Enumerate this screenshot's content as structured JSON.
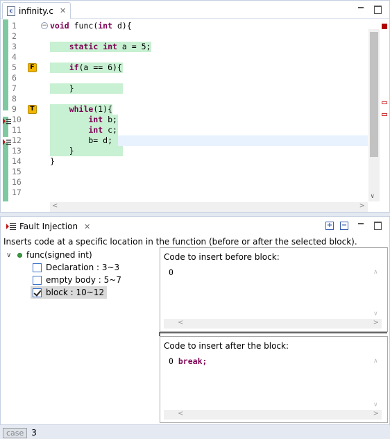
{
  "editor": {
    "tab_label": "infinity.c",
    "file_icon_glyph": "c",
    "lines": [
      {
        "no": "1",
        "code": "void func(int d){",
        "kw": true,
        "fold": true
      },
      {
        "no": "2",
        "code": ""
      },
      {
        "no": "3",
        "code": "    static int a = 5;",
        "hl": true
      },
      {
        "no": "4",
        "code": ""
      },
      {
        "no": "5",
        "code": "    if(a == 6){",
        "hl": true,
        "marker": "F"
      },
      {
        "no": "6",
        "code": ""
      },
      {
        "no": "7",
        "code": "    }",
        "hl": true
      },
      {
        "no": "8",
        "code": ""
      },
      {
        "no": "9",
        "code": "    while(1){",
        "hl": true,
        "marker": "T"
      },
      {
        "no": "10",
        "code": "        int b;",
        "hl": true,
        "bp": true
      },
      {
        "no": "11",
        "code": "        int c;",
        "hl": true
      },
      {
        "no": "12",
        "code": "        b= d;",
        "hl": true,
        "bp": true,
        "selected": true
      },
      {
        "no": "13",
        "code": "    }",
        "hl": true
      },
      {
        "no": "14",
        "code": "}"
      },
      {
        "no": "15",
        "code": ""
      },
      {
        "no": "16",
        "code": ""
      },
      {
        "no": "17",
        "code": ""
      }
    ]
  },
  "fault_injection": {
    "tab_label": "Fault Injection",
    "description": "Inserts code at a specific location in the function (before or after the selected block).",
    "tree": {
      "function": "func(signed int)",
      "items": [
        {
          "label": "Declaration : 3~3",
          "checked": false
        },
        {
          "label": "empty body : 5~7",
          "checked": false
        },
        {
          "label": "block : 10~12",
          "checked": true,
          "selected": true
        }
      ]
    },
    "before_panel": {
      "title": "Code to insert before block:",
      "code": "0"
    },
    "after_panel": {
      "title": "Code to insert after the block:",
      "line_no": "0",
      "code": "break;"
    }
  },
  "status": {
    "badge": "case",
    "value": "3"
  },
  "colors": {
    "coverage_green": "#c8f0d2",
    "marker_yellow": "#f2b600",
    "keyword": "#7f0055"
  }
}
